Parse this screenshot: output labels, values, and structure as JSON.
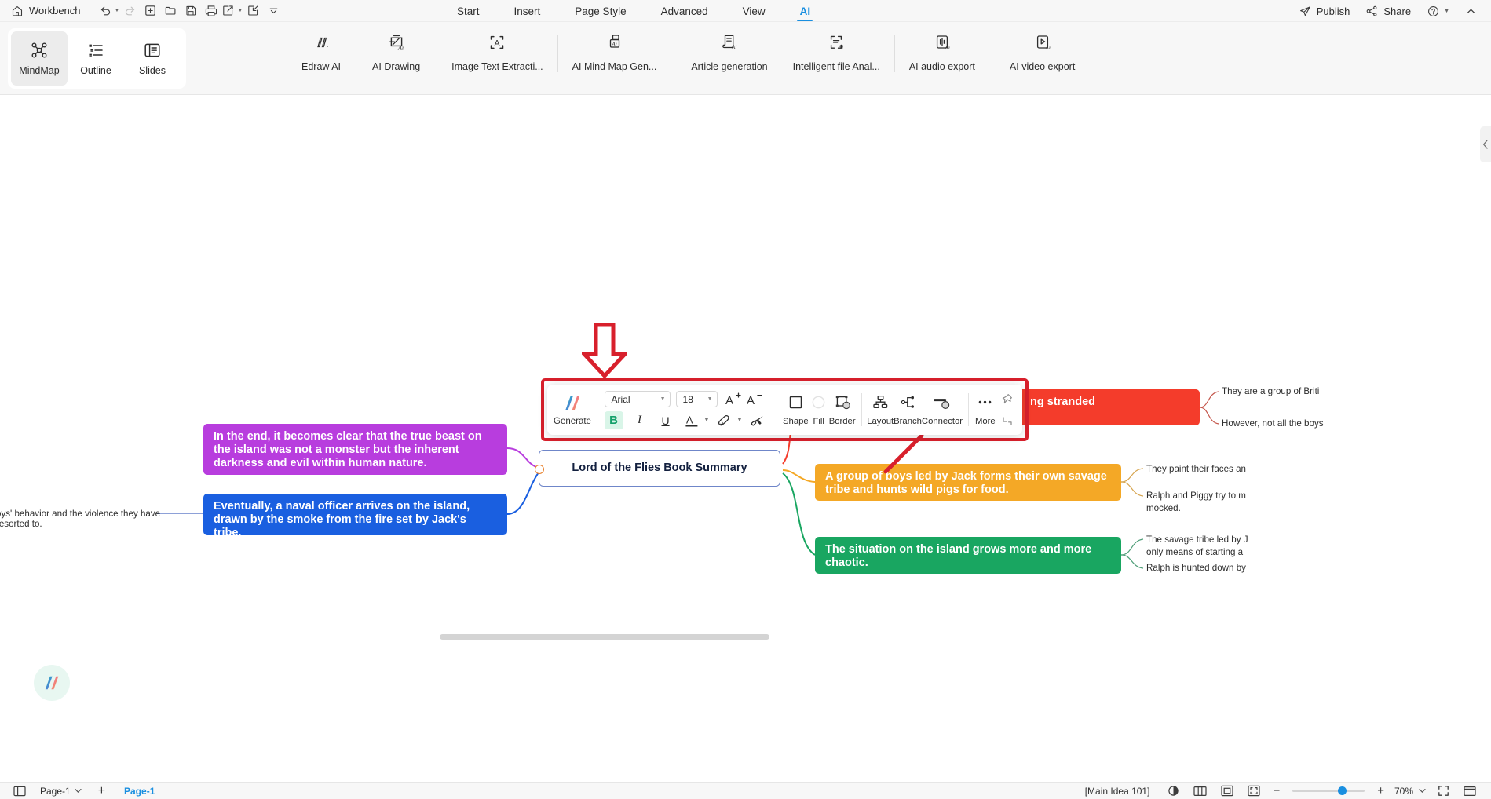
{
  "titlebar": {
    "home_label": "Workbench",
    "quick_actions": [
      {
        "name": "undo-button",
        "icon": "undo-icon",
        "has_caret": true
      },
      {
        "name": "redo-button",
        "icon": "redo-icon",
        "has_caret": false,
        "disabled": true
      },
      {
        "name": "new-button",
        "icon": "plus-square-icon",
        "has_caret": false
      },
      {
        "name": "open-button",
        "icon": "folder-icon",
        "has_caret": false
      },
      {
        "name": "save-button",
        "icon": "floppy-disk-icon",
        "has_caret": false
      },
      {
        "name": "print-button",
        "icon": "printer-icon",
        "has_caret": false
      },
      {
        "name": "export-button",
        "icon": "share-export-icon",
        "has_caret": true
      },
      {
        "name": "import-button",
        "icon": "import-icon",
        "has_caret": false
      },
      {
        "name": "customize-quick-access-button",
        "icon": "chevron-down-icon",
        "has_caret": false
      }
    ],
    "menus": [
      {
        "label": "Start",
        "active": false
      },
      {
        "label": "Insert",
        "active": false
      },
      {
        "label": "Page Style",
        "active": false
      },
      {
        "label": "Advanced",
        "active": false
      },
      {
        "label": "View",
        "active": false
      },
      {
        "label": "AI",
        "active": true
      }
    ],
    "publish_label": "Publish",
    "share_label": "Share",
    "accent_color": "#1a8fe0"
  },
  "ribbon": {
    "view_modes": [
      {
        "label": "MindMap",
        "icon": "mindmap-icon",
        "active": true
      },
      {
        "label": "Outline",
        "icon": "outline-list-icon",
        "active": false
      },
      {
        "label": "Slides",
        "icon": "slides-icon",
        "active": false
      }
    ],
    "ai_tools": [
      {
        "label": "Edraw AI",
        "icon": "edraw-ai-icon"
      },
      {
        "label": "AI Drawing",
        "icon": "ai-drawing-icon"
      },
      {
        "label": "Image Text Extracti...",
        "icon": "image-text-extract-icon"
      },
      {
        "label": "AI Mind Map Gen...",
        "icon": "ai-mindmap-gen-icon"
      },
      {
        "label": "Article generation",
        "icon": "article-generation-icon"
      },
      {
        "label": "Intelligent file Anal...",
        "icon": "intelligent-file-analysis-icon"
      },
      {
        "label": "AI audio export",
        "icon": "ai-audio-export-icon"
      },
      {
        "label": "AI video export",
        "icon": "ai-video-export-icon"
      }
    ]
  },
  "format_toolbar": {
    "generate_label": "Generate",
    "font_family": "Arial",
    "font_size": "18",
    "increase_font_label": "A",
    "decrease_font_label": "A",
    "bold_label": "B",
    "italic_label": "I",
    "underline_label": "U",
    "font_color_label": "A",
    "tools": [
      {
        "label": "Shape",
        "icon": "shape-square-icon"
      },
      {
        "label": "Fill",
        "icon": "fill-circle-icon"
      },
      {
        "label": "Border",
        "icon": "border-icon"
      },
      {
        "label": "Layout",
        "icon": "layout-hierarchy-icon"
      },
      {
        "label": "Branch",
        "icon": "branch-icon"
      },
      {
        "label": "Connector",
        "icon": "connector-icon"
      },
      {
        "label": "More",
        "icon": "more-dots-icon"
      }
    ]
  },
  "mindmap": {
    "central": "Lord of the Flies Book Summary",
    "nodes": [
      {
        "id": "node-purple",
        "text": "In the end, it becomes clear that the true beast on the island was not a monster but the inherent darkness and evil within human nature.",
        "color": "#b83dde"
      },
      {
        "id": "node-blue",
        "text": "Eventually, a naval officer arrives on the island, drawn by the smoke from the fire set by Jack's tribe.",
        "color": "#1a5fe0"
      },
      {
        "id": "node-red",
        "text": "ing stranded",
        "color": "#f43c2b"
      },
      {
        "id": "node-orange",
        "text": "A group of boys led by Jack forms their own savage tribe and hunts wild pigs for food.",
        "color": "#f4a826"
      },
      {
        "id": "node-green",
        "text": "The situation on the island grows more and more chaotic.",
        "color": "#19a661"
      }
    ],
    "sub_nodes": [
      {
        "id": "sub-red-1",
        "text": "They are a group of Briti"
      },
      {
        "id": "sub-red-2",
        "text": "However, not all the boys"
      },
      {
        "id": "sub-orange-1",
        "text": "They paint their faces an"
      },
      {
        "id": "sub-orange-2",
        "text": "Ralph and Piggy try to m\nmocked."
      },
      {
        "id": "sub-green-1",
        "text": "The savage tribe led by J\nonly means of starting a"
      },
      {
        "id": "sub-green-2",
        "text": "Ralph is hunted down by"
      }
    ],
    "left_stub": "oys' behavior and the violence they have resorted to."
  },
  "statusbar": {
    "page_label": "Page-1",
    "page_tab_label": "Page-1",
    "add_page_label": "+",
    "main_idea_label": "[Main Idea 101]",
    "zoom_level": "70%",
    "right_icons": [
      {
        "name": "theme-contrast-icon"
      },
      {
        "name": "two-page-view-icon"
      },
      {
        "name": "fit-page-icon"
      },
      {
        "name": "fit-width-icon"
      }
    ],
    "zoom_out_label": "−",
    "zoom_in_label": "+",
    "fullscreen_icon": "fullscreen-icon",
    "presentation_icon": "presentation-icon",
    "accent_color": "#1a8fe0"
  }
}
